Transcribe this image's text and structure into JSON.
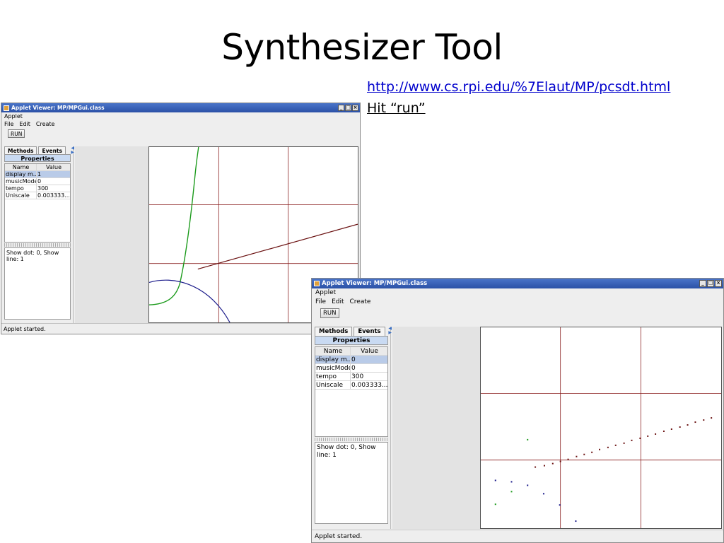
{
  "slide": {
    "title": "Synthesizer Tool",
    "link": "http://www.cs.rpi.edu/%7Elaut/MP/pcsdt.html",
    "note": "Hit “run”"
  },
  "windows": [
    {
      "title": "Applet Viewer: MP/MPGui.class",
      "applet_menu": "Applet",
      "menu": [
        "File",
        "Edit",
        "Create"
      ],
      "run_label": "RUN",
      "tabs": [
        "Methods",
        "Events"
      ],
      "properties_label": "Properties",
      "table_headers": [
        "Name",
        "Value"
      ],
      "rows": [
        {
          "name": "display m...",
          "value": "1",
          "selected": true
        },
        {
          "name": "musicMode",
          "value": "0",
          "selected": false
        },
        {
          "name": "tempo",
          "value": "300",
          "selected": false
        },
        {
          "name": "Uniscale",
          "value": "0.003333...",
          "selected": false
        }
      ],
      "console": "Show dot: 0, Show line: 1",
      "status": "Applet started.",
      "plot_mode": "line"
    },
    {
      "title": "Applet Viewer: MP/MPGui.class",
      "applet_menu": "Applet",
      "menu": [
        "File",
        "Edit",
        "Create"
      ],
      "run_label": "RUN",
      "tabs": [
        "Methods",
        "Events"
      ],
      "properties_label": "Properties",
      "table_headers": [
        "Name",
        "Value"
      ],
      "rows": [
        {
          "name": "display m...",
          "value": "0",
          "selected": true
        },
        {
          "name": "musicMode",
          "value": "0",
          "selected": false
        },
        {
          "name": "tempo",
          "value": "300",
          "selected": false
        },
        {
          "name": "Uniscale",
          "value": "0.003333...",
          "selected": false
        }
      ],
      "console": "Show dot: 0, Show line: 1",
      "status": "Applet started.",
      "plot_mode": "dots"
    }
  ],
  "colors": {
    "grid": "#8b2020",
    "green_curve": "#1a9a1a",
    "blue_curve": "#1a1a8a",
    "red_line": "#6a1010",
    "titlebar": "#2b51a6"
  }
}
